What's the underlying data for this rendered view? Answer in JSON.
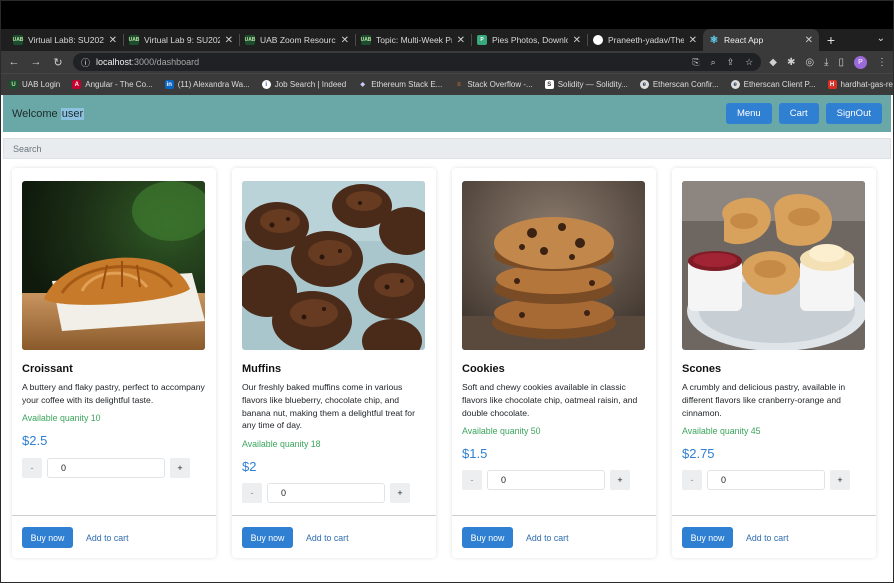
{
  "browser": {
    "tabs": [
      {
        "title": "Virtual Lab8: SU2023 C",
        "favicon": "uab-icon",
        "active": false
      },
      {
        "title": "Virtual Lab 9: SU2023 C",
        "favicon": "uab-icon",
        "active": false
      },
      {
        "title": "UAB Zoom Resources",
        "favicon": "uab-icon",
        "active": false
      },
      {
        "title": "Topic: Multi-Week Proje",
        "favicon": "uab-icon",
        "active": false
      },
      {
        "title": "Pies Photos, Download",
        "favicon": "pies-icon",
        "active": false
      },
      {
        "title": "Praneeth-yadav/TheCo",
        "favicon": "github-icon",
        "active": false
      },
      {
        "title": "React App",
        "favicon": "react-icon",
        "active": true
      }
    ],
    "url_host": "localhost",
    "url_path": ":3000/dashboard",
    "profile_initial": "P",
    "bookmarks": [
      {
        "label": "UAB Login",
        "icon": "uab-icon"
      },
      {
        "label": "Angular - The Co...",
        "icon": "angular-icon"
      },
      {
        "label": "(11) Alexandra Wa...",
        "icon": "linkedin-icon"
      },
      {
        "label": "Job Search | Indeed",
        "icon": "indeed-icon"
      },
      {
        "label": "Ethereum Stack E...",
        "icon": "ethereum-icon"
      },
      {
        "label": "Stack Overflow -...",
        "icon": "stackoverflow-icon"
      },
      {
        "label": "Solidity — Solidity...",
        "icon": "solidity-icon"
      },
      {
        "label": "Etherscan Confir...",
        "icon": "etherscan-icon"
      },
      {
        "label": "Etherscan Client P...",
        "icon": "etherscan-icon"
      },
      {
        "label": "hardhat-gas-repo...",
        "icon": "hardhat-icon"
      }
    ]
  },
  "header": {
    "welcome_text": "Welcome",
    "user_name": "user",
    "menu_label": "Menu",
    "cart_label": "Cart",
    "signout_label": "SignOut",
    "bg_color": "#6aa8a8",
    "accent_color": "#2f7fd2"
  },
  "search": {
    "placeholder": "Search"
  },
  "products": [
    {
      "name": "Croissant",
      "description": "A buttery and flaky pastry, perfect to accompany your coffee with its delightful taste.",
      "quantity_text": "Available quanity 10",
      "price": "$2.5",
      "qty_value": "0",
      "minus": "-",
      "plus": "+",
      "buy_label": "Buy now",
      "cart_label": "Add to cart"
    },
    {
      "name": "Muffins",
      "description": "Our freshly baked muffins come in various flavors like blueberry, chocolate chip, and banana nut, making them a delightful treat for any time of day.",
      "quantity_text": "Available quanity 18",
      "price": "$2",
      "qty_value": "0",
      "minus": "-",
      "plus": "+",
      "buy_label": "Buy now",
      "cart_label": "Add to cart"
    },
    {
      "name": "Cookies",
      "description": "Soft and chewy cookies available in classic flavors like chocolate chip, oatmeal raisin, and double chocolate.",
      "quantity_text": "Available quanity 50",
      "price": "$1.5",
      "qty_value": "0",
      "minus": "-",
      "plus": "+",
      "buy_label": "Buy now",
      "cart_label": "Add to cart"
    },
    {
      "name": "Scones",
      "description": "A crumbly and delicious pastry, available in different flavors like cranberry-orange and cinnamon.",
      "quantity_text": "Available quanity 45",
      "price": "$2.75",
      "qty_value": "0",
      "minus": "-",
      "plus": "+",
      "buy_label": "Buy now",
      "cart_label": "Add to cart"
    }
  ]
}
